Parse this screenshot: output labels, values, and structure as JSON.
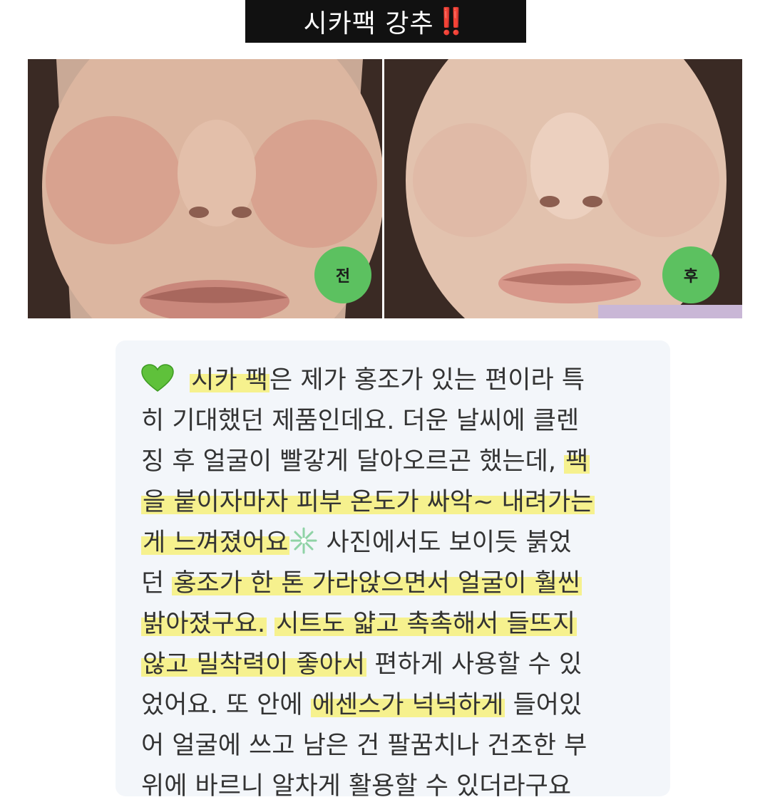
{
  "header": {
    "title": "시카팩 강추",
    "emphasis": "‼️"
  },
  "photos": {
    "before_label": "전",
    "after_label": "후"
  },
  "review": {
    "lines": [
      [
        "시카 팩",
        "은 제가 홍조가 있는 편이라 특"
      ],
      [
        "히 기대했던 제품인데요. 더운 날씨에 클렌"
      ],
      [
        "징 후 얼굴이 빨갛게 달아오르곤 했는데, ",
        "팩"
      ],
      [
        "을 붙이자마자 피부 온도가 싸악~ 내려가는"
      ],
      [
        "게 느껴졌어요",
        "사진에서도 보이듯 붉었"
      ],
      [
        "던 ",
        "홍조가 한 톤 가라앉으면서 얼굴이 훨씬"
      ],
      [
        "밝아졌구요.",
        "시트도 얇고 촉촉해서 들뜨지"
      ],
      [
        "않고 밀착력이 좋아서",
        " 편하게 사용할 수 있"
      ],
      [
        "었어요. 또 안에 ",
        "에센스가 넉넉하게",
        " 들어있"
      ],
      [
        "어 얼굴에 쓰고 남은 건 팔꿈치나 건조한 부"
      ],
      [
        "위에 바르니 알차게 활용할 수 있더라구요"
      ]
    ]
  },
  "colors": {
    "badge_green": "#5cc160",
    "highlight_yellow": "#f6f18e",
    "title_bg": "#111111"
  },
  "icons": {
    "heart": "green-heart-icon",
    "snowflake": "snowflake-icon"
  }
}
